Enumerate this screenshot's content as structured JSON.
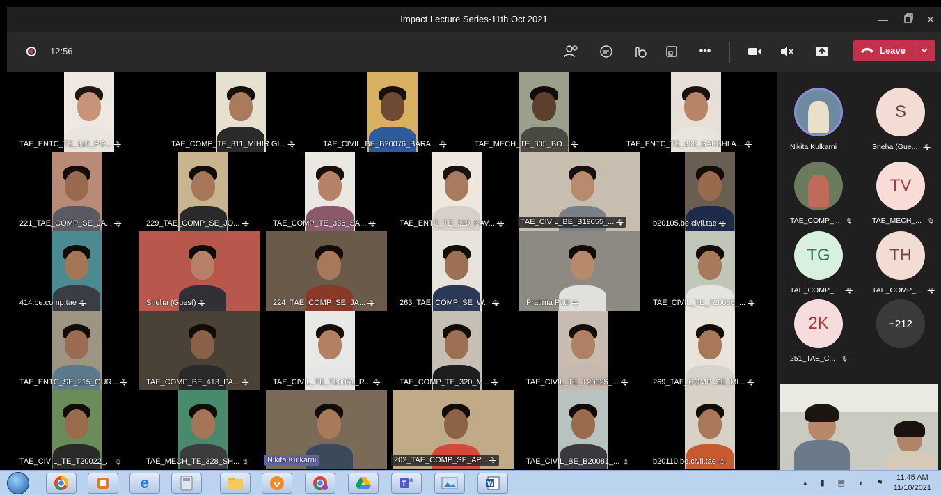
{
  "window": {
    "title": "Impact Lecture Series-11th Oct 2021"
  },
  "toolbar": {
    "time": "12:56",
    "leave_label": "Leave"
  },
  "participants": [
    "TAE_ENTC_TE_315_PO...",
    "TAE_COMP_TE_311_MIHIR GI...",
    "TAE_CIVIL_BE_B20076_BARA...",
    "TAE_MECH_TE_305_BO...",
    "TAE_ENTC_TE_308_SAKSHI A...",
    "221_TAE_COMP_SE_JA...",
    "229_TAE_COMP_SE_JO...",
    "TAE_COMP_TE_336_SA...",
    "TAE_ENTC_TE_319_KAV...",
    "TAE_CIVIL_BE_B19055_...",
    "b20105.be.civil.tae",
    "414.be.comp.tae",
    "Sneha (Guest)",
    "224_TAE_COMP_SE_JA...",
    "263_TAE_COMP_SE_W...",
    "Pratima Patil",
    "TAE_CIVIL_TE_T20056_...",
    "TAE_ENTC_SE_215_GUR...",
    "TAE_COMP_BE_413_PA...",
    "TAE_CIVIL_TE_T20051_R...",
    "TAE_COMP_TE_320_M...",
    "TAE_CIVIL_TE_T20025_...",
    "269_TAE_COMP_SE_MI...",
    "TAE_CIVIL_TE_T20022_...",
    "TAE_MECH_TE_328_SH...",
    "Nikita Kulkarni",
    "202_TAE_COMP_SE_AP...",
    "TAE_CIVIL_BE_B20081_...",
    "b20110.be.civil.tae"
  ],
  "sidebar": [
    {
      "initials": "",
      "name": "Nikita Kulkarni",
      "color": "#6d8aa0"
    },
    {
      "initials": "S",
      "name": "Sneha (Gue...",
      "color": "#f2dcd4"
    },
    {
      "initials": "",
      "name": "TAE_COMP_...",
      "color": "#6c7a5e"
    },
    {
      "initials": "TV",
      "name": "TAE_MECH_...",
      "color": "#f8dcd8"
    },
    {
      "initials": "TG",
      "name": "TAE_COMP_...",
      "color": "#d8f0e0"
    },
    {
      "initials": "TH",
      "name": "TAE_COMP_...",
      "color": "#f2dcd4"
    },
    {
      "initials": "2K",
      "name": "251_TAE_C...",
      "color": "#f6dcdc"
    },
    {
      "initials": "+212",
      "name": "",
      "color": "#3a3a3a"
    }
  ],
  "taskbar": {
    "time": "11:45 AM",
    "date": "11/10/2021"
  }
}
